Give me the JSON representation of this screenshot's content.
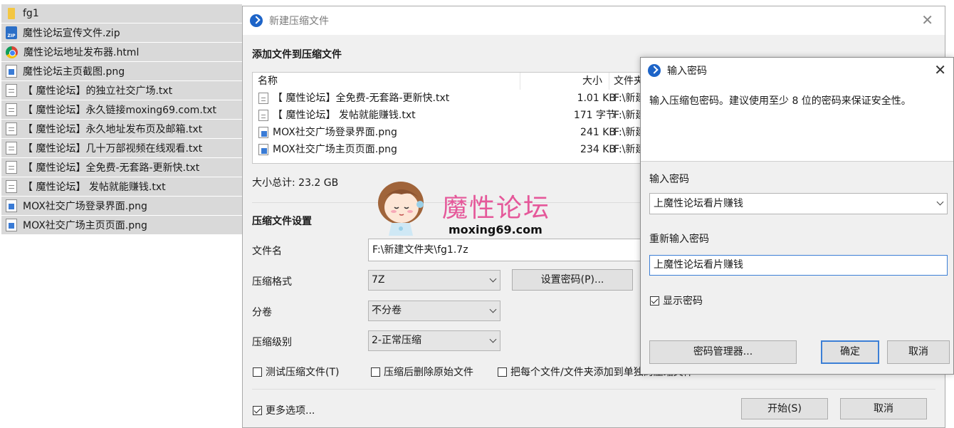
{
  "file_list": [
    {
      "icon": "folder-icon",
      "name": "fg1"
    },
    {
      "icon": "zip-file-icon",
      "name": "魔性论坛宣传文件.zip"
    },
    {
      "icon": "chrome-icon",
      "name": "魔性论坛地址发布器.html"
    },
    {
      "icon": "image-file-icon",
      "name": "魔性论坛主页截图.png"
    },
    {
      "icon": "text-file-icon",
      "name": "【 魔性论坛】的独立社交广场.txt"
    },
    {
      "icon": "text-file-icon",
      "name": "【 魔性论坛】永久链接moxing69.com.txt"
    },
    {
      "icon": "text-file-icon",
      "name": "【 魔性论坛】永久地址发布页及邮箱.txt"
    },
    {
      "icon": "text-file-icon",
      "name": "【 魔性论坛】几十万部视频在线观看.txt"
    },
    {
      "icon": "text-file-icon",
      "name": "【 魔性论坛】全免费-无套路-更新快.txt"
    },
    {
      "icon": "text-file-icon",
      "name": "【 魔性论坛】 发帖就能赚钱.txt"
    },
    {
      "icon": "image-file-icon",
      "name": "MOX社交广场登录界面.png"
    },
    {
      "icon": "image-file-icon",
      "name": "MOX社交广场主页页面.png"
    }
  ],
  "main_dialog": {
    "title": "新建压缩文件",
    "add_files_heading": "添加文件到压缩文件",
    "table": {
      "col_name": "名称",
      "col_size": "大小",
      "col_path": "文件夹",
      "rows": [
        {
          "icon": "text-file-icon",
          "name": "【 魔性论坛】全免费-无套路-更新快.txt",
          "size": "1.01 KB",
          "path": "F:\\新建"
        },
        {
          "icon": "text-file-icon",
          "name": "【 魔性论坛】 发帖就能赚钱.txt",
          "size": "171 字节",
          "path": "F:\\新建"
        },
        {
          "icon": "image-file-icon",
          "name": "MOX社交广场登录界面.png",
          "size": "241 KB",
          "path": "F:\\新建"
        },
        {
          "icon": "image-file-icon",
          "name": "MOX社交广场主页页面.png",
          "size": "234 KB",
          "path": "F:\\新建"
        }
      ]
    },
    "total_size": "大小总计: 23.2 GB",
    "settings_heading": "压缩文件设置",
    "filename_label": "文件名",
    "filename_value": "F:\\新建文件夹\\fg1.7z",
    "format_label": "压缩格式",
    "format_value": "7Z",
    "set_password_button": "设置密码(P)...",
    "split_label": "分卷",
    "split_value": "不分卷",
    "level_label": "压缩级别",
    "level_value": "2-正常压缩",
    "test_checkbox": "测试压缩文件(T)",
    "delete_checkbox": "压缩后删除原始文件",
    "each_checkbox": "把每个文件/文件夹添加到单独的压缩文件",
    "more_options": "更多选项...",
    "start_button": "开始(S)",
    "cancel_button": "取消"
  },
  "password_dialog": {
    "title": "输入密码",
    "description": "输入压缩包密码。建议使用至少 8 位的密码来保证安全性。",
    "enter_label": "输入密码",
    "enter_value": "上魔性论坛看片赚钱",
    "reenter_label": "重新输入密码",
    "reenter_value": "上魔性论坛看片赚钱",
    "show_password": "显示密码",
    "show_password_checked": true,
    "manager_button": "密码管理器...",
    "ok_button": "确定",
    "cancel_button": "取消"
  },
  "watermark": {
    "title": "魔性论坛",
    "url": "moxing69.com"
  },
  "colors": {
    "accent": "#3c7fd6",
    "watermark_pink": "#e5589a",
    "file_row_bg": "#d9d9d9"
  }
}
